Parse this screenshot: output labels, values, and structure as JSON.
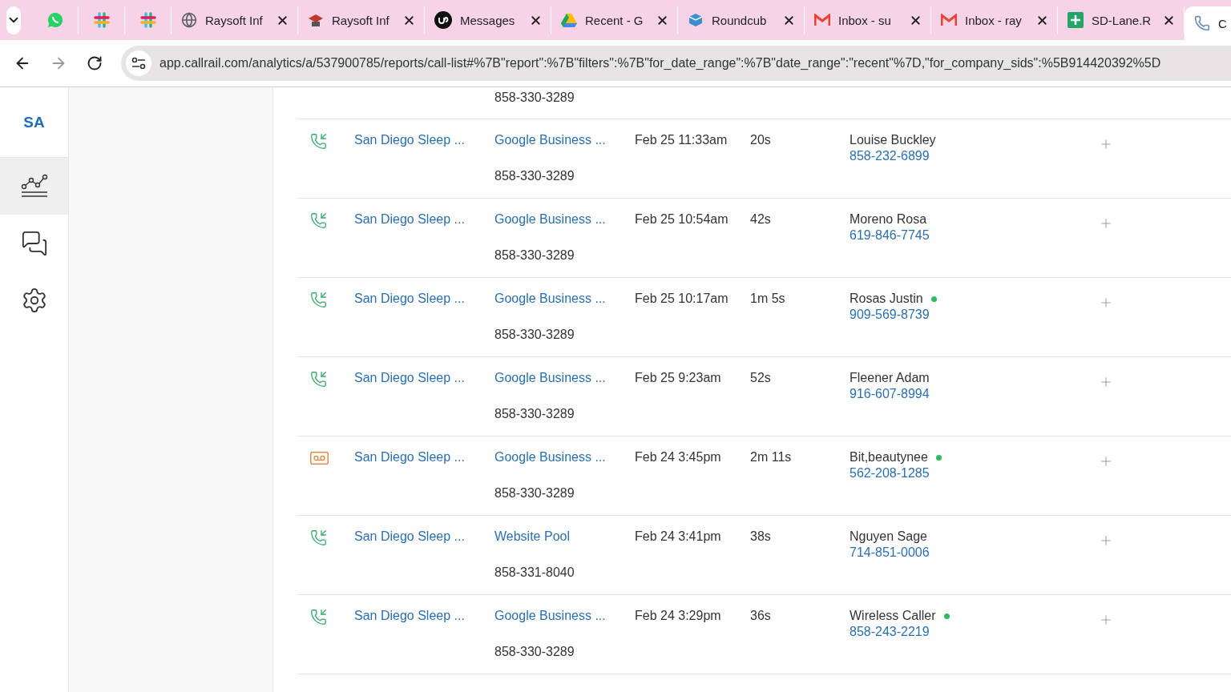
{
  "browser": {
    "tabs": [
      {
        "selected": false
      },
      {
        "selected": false
      },
      {
        "selected": false
      },
      {
        "title": "Raysoft Inf",
        "selected": false
      },
      {
        "title": "Raysoft Inf",
        "selected": false
      },
      {
        "title": "Messages",
        "selected": false
      },
      {
        "title": "Recent - G",
        "selected": false
      },
      {
        "title": "Roundcub",
        "selected": false
      },
      {
        "title": "Inbox - su",
        "selected": false
      },
      {
        "title": "Inbox - ray",
        "selected": false
      },
      {
        "title": "SD-Lane.R",
        "selected": false
      },
      {
        "title": "C",
        "selected": true
      }
    ],
    "url": "app.callrail.com/analytics/a/537900785/reports/call-list#%7B\"report\":%7B\"filters\":%7B\"for_date_range\":%7B\"date_range\":\"recent\"%7D,\"for_company_sids\":%5B914420392%5D"
  },
  "sidebar": {
    "account": "SA",
    "items": [
      {
        "selected": true
      },
      {
        "selected": false
      },
      {
        "selected": false
      }
    ]
  },
  "calls": [
    {
      "tracking_number": "858-330-3289"
    },
    {
      "kind": "call",
      "company": "San Diego Sleep ...",
      "source": "Google Business ...",
      "tracking_number": "858-330-3289",
      "date": "Feb 25 11:33am",
      "duration": "20s",
      "caller": "Louise Buckley",
      "online": false,
      "caller_number": "858-232-6899"
    },
    {
      "kind": "call",
      "company": "San Diego Sleep ...",
      "source": "Google Business ...",
      "tracking_number": "858-330-3289",
      "date": "Feb 25 10:54am",
      "duration": "42s",
      "caller": "Moreno Rosa",
      "online": false,
      "caller_number": "619-846-7745"
    },
    {
      "kind": "call",
      "company": "San Diego Sleep ...",
      "source": "Google Business ...",
      "tracking_number": "858-330-3289",
      "date": "Feb 25 10:17am",
      "duration": "1m 5s",
      "caller": "Rosas Justin",
      "online": true,
      "caller_number": "909-569-8739"
    },
    {
      "kind": "call",
      "company": "San Diego Sleep ...",
      "source": "Google Business ...",
      "tracking_number": "858-330-3289",
      "date": "Feb 25 9:23am",
      "duration": "52s",
      "caller": "Fleener Adam",
      "online": false,
      "caller_number": "916-607-8994"
    },
    {
      "kind": "voicemail",
      "company": "San Diego Sleep ...",
      "source": "Google Business ...",
      "tracking_number": "858-330-3289",
      "date": "Feb 24 3:45pm",
      "duration": "2m 11s",
      "caller": "Bit,beautynee",
      "online": true,
      "caller_number": "562-208-1285"
    },
    {
      "kind": "call",
      "company": "San Diego Sleep ...",
      "source": "Website Pool",
      "tracking_number": "858-331-8040",
      "date": "Feb 24 3:41pm",
      "duration": "38s",
      "caller": "Nguyen Sage",
      "online": false,
      "caller_number": "714-851-0006"
    },
    {
      "kind": "call",
      "company": "San Diego Sleep ...",
      "source": "Google Business ...",
      "tracking_number": "858-330-3289",
      "date": "Feb 24 3:29pm",
      "duration": "36s",
      "caller": "Wireless Caller",
      "online": true,
      "caller_number": "858-243-2219"
    }
  ]
}
